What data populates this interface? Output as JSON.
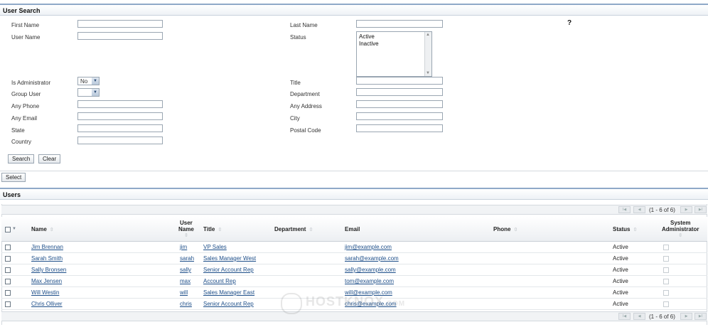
{
  "search_panel": {
    "title": "User Search",
    "help_label": "?",
    "labels": {
      "first_name": "First Name",
      "user_name": "User Name",
      "is_administrator": "Is Administrator",
      "group_user": "Group User",
      "any_phone": "Any Phone",
      "any_email": "Any Email",
      "state": "State",
      "country": "Country",
      "last_name": "Last Name",
      "status": "Status",
      "title": "Title",
      "department": "Department",
      "any_address": "Any Address",
      "city": "City",
      "postal_code": "Postal Code"
    },
    "status_options": [
      "Active",
      "Inactive"
    ],
    "is_administrator_value": "No",
    "group_user_value": "",
    "search_button": "Search",
    "clear_button": "Clear",
    "select_button": "Select"
  },
  "users_panel": {
    "title": "Users",
    "pagination": "(1 - 6 of 6)",
    "columns": {
      "name": "Name",
      "user_name_l1": "User",
      "user_name_l2": "Name",
      "title": "Title",
      "department": "Department",
      "email": "Email",
      "phone": "Phone",
      "status": "Status",
      "sysadmin_l1": "System",
      "sysadmin_l2": "Administrator"
    },
    "rows": [
      {
        "name": "Jim Brennan",
        "user": "jim",
        "title": "VP Sales",
        "department": "",
        "email": "jim@example.com",
        "phone": "",
        "status": "Active",
        "admin": false
      },
      {
        "name": "Sarah Smith",
        "user": "sarah",
        "title": "Sales Manager West",
        "department": "",
        "email": "sarah@example.com",
        "phone": "",
        "status": "Active",
        "admin": false
      },
      {
        "name": "Sally Bronsen",
        "user": "sally",
        "title": "Senior Account Rep",
        "department": "",
        "email": "sally@example.com",
        "phone": "",
        "status": "Active",
        "admin": false
      },
      {
        "name": "Max Jensen",
        "user": "max",
        "title": "Account Rep",
        "department": "",
        "email": "tom@example.com",
        "phone": "",
        "status": "Active",
        "admin": false
      },
      {
        "name": "Will Westin",
        "user": "will",
        "title": "Sales Manager East",
        "department": "",
        "email": "will@example.com",
        "phone": "",
        "status": "Active",
        "admin": false
      },
      {
        "name": "Chris Olliver",
        "user": "chris",
        "title": "Senior Account Rep",
        "department": "",
        "email": "chris@example.com",
        "phone": "",
        "status": "Active",
        "admin": false
      }
    ]
  },
  "watermark": {
    "text": "HOSTKNOX",
    "suffix": ".COM"
  }
}
